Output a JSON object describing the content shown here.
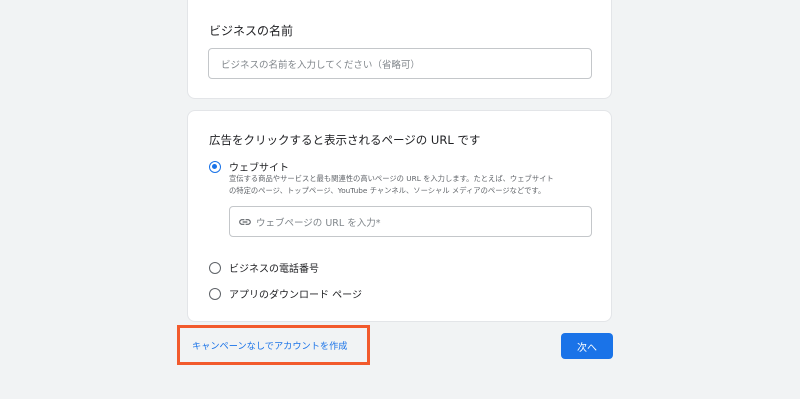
{
  "business_name": {
    "title": "ビジネスの名前",
    "placeholder": "ビジネスの名前を入力してください（省略可）"
  },
  "destination": {
    "title": "広告をクリックすると表示されるページの URL です",
    "options": [
      {
        "label": "ウェブサイト",
        "selected": true,
        "description_lines": [
          "宣伝する商品やサービスと最も関連性の高いページの URL を入力します。たとえば、ウェブサイト",
          "の特定のページ、トップページ、YouTube チャンネル、ソーシャル メディアのページなどです。"
        ],
        "input_placeholder": "ウェブページの URL を入力*",
        "input_icon": "link-icon"
      },
      {
        "label": "ビジネスの電話番号",
        "selected": false
      },
      {
        "label": "アプリのダウンロード ページ",
        "selected": false
      }
    ]
  },
  "footer": {
    "create_without_campaign": "キャンペーンなしでアカウントを作成",
    "next_button": "次へ",
    "highlight_color": "#f25a2c",
    "accent_color": "#1a73e8"
  }
}
